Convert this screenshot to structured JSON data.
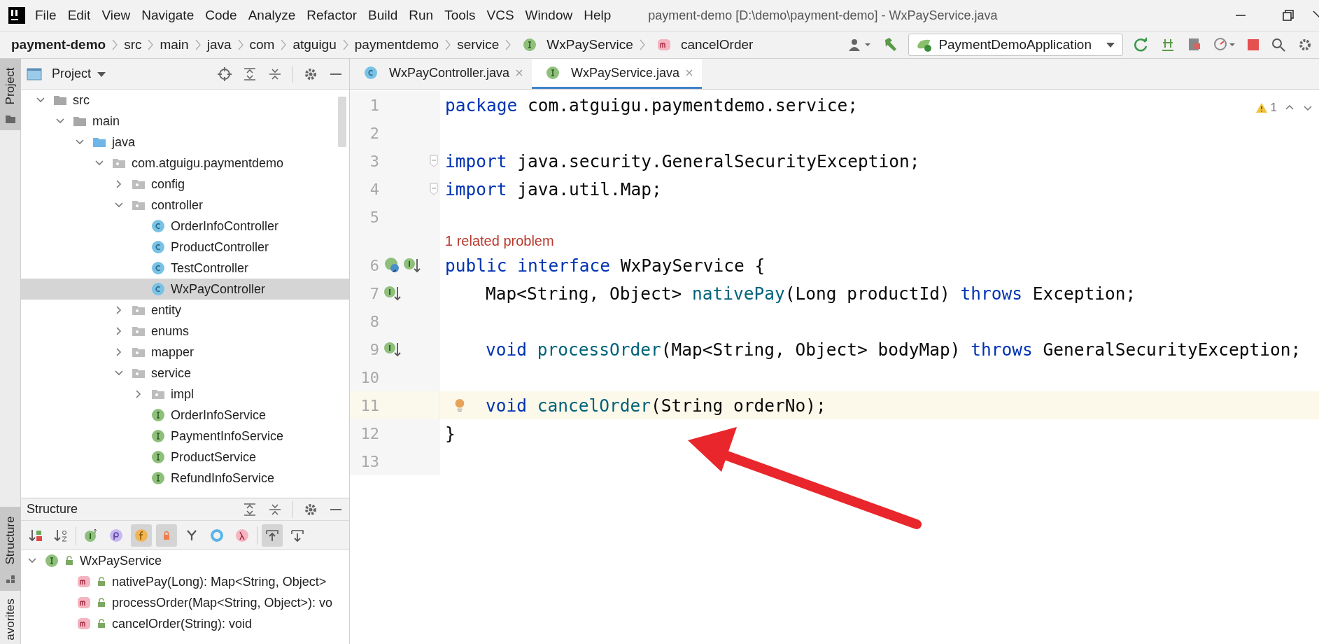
{
  "menu": [
    {
      "label": "File"
    },
    {
      "label": "Edit"
    },
    {
      "label": "View"
    },
    {
      "label": "Navigate"
    },
    {
      "label": "Code"
    },
    {
      "label": "Analyze"
    },
    {
      "label": "Refactor"
    },
    {
      "label": "Build"
    },
    {
      "label": "Run"
    },
    {
      "label": "Tools"
    },
    {
      "label": "VCS"
    },
    {
      "label": "Window"
    },
    {
      "label": "Help"
    }
  ],
  "window_title": "payment-demo [D:\\demo\\payment-demo] - WxPayService.java",
  "breadcrumbs": [
    {
      "label": "payment-demo",
      "kind": "project"
    },
    {
      "label": "src",
      "kind": "plain"
    },
    {
      "label": "main",
      "kind": "plain"
    },
    {
      "label": "java",
      "kind": "plain"
    },
    {
      "label": "com",
      "kind": "plain"
    },
    {
      "label": "atguigu",
      "kind": "plain"
    },
    {
      "label": "paymentdemo",
      "kind": "plain"
    },
    {
      "label": "service",
      "kind": "plain"
    },
    {
      "label": "WxPayService",
      "kind": "interface"
    },
    {
      "label": "cancelOrder",
      "kind": "method"
    }
  ],
  "run_config": "PaymentDemoApplication",
  "side_stripe": {
    "top": {
      "label": "Project",
      "selected": true
    },
    "middle": {
      "label": "Structure",
      "selected": true
    },
    "bottom": {
      "label": "avorites",
      "selected": false
    }
  },
  "project_panel": {
    "title": "Project",
    "tree": [
      {
        "label": "src",
        "kind": "folder",
        "expanded": true,
        "selected": false,
        "children": [
          {
            "label": "main",
            "kind": "folder",
            "expanded": true,
            "selected": false,
            "children": [
              {
                "label": "java",
                "kind": "source",
                "expanded": true,
                "selected": false,
                "children": [
                  {
                    "label": "com.atguigu.paymentdemo",
                    "kind": "package",
                    "expanded": true,
                    "selected": false,
                    "children": [
                      {
                        "label": "config",
                        "kind": "package",
                        "expanded": false,
                        "selected": false
                      },
                      {
                        "label": "controller",
                        "kind": "package",
                        "expanded": true,
                        "selected": false,
                        "children": [
                          {
                            "label": "OrderInfoController",
                            "kind": "class",
                            "selected": false
                          },
                          {
                            "label": "ProductController",
                            "kind": "class",
                            "selected": false
                          },
                          {
                            "label": "TestController",
                            "kind": "class",
                            "selected": false
                          },
                          {
                            "label": "WxPayController",
                            "kind": "class",
                            "selected": true
                          }
                        ]
                      },
                      {
                        "label": "entity",
                        "kind": "package",
                        "expanded": false,
                        "selected": false
                      },
                      {
                        "label": "enums",
                        "kind": "package",
                        "expanded": false,
                        "selected": false
                      },
                      {
                        "label": "mapper",
                        "kind": "package",
                        "expanded": false,
                        "selected": false
                      },
                      {
                        "label": "service",
                        "kind": "package",
                        "expanded": true,
                        "selected": false,
                        "children": [
                          {
                            "label": "impl",
                            "kind": "package",
                            "expanded": false,
                            "selected": false
                          },
                          {
                            "label": "OrderInfoService",
                            "kind": "interface",
                            "selected": false
                          },
                          {
                            "label": "PaymentInfoService",
                            "kind": "interface",
                            "selected": false
                          },
                          {
                            "label": "ProductService",
                            "kind": "interface",
                            "selected": false
                          },
                          {
                            "label": "RefundInfoService",
                            "kind": "interface",
                            "selected": false
                          }
                        ]
                      }
                    ]
                  }
                ]
              }
            ]
          }
        ]
      }
    ]
  },
  "structure_panel": {
    "title": "Structure",
    "toolbar": [
      {
        "kind": "sort-visibility",
        "on": false
      },
      {
        "kind": "sort-alpha",
        "on": false
      },
      {
        "kind": "inherited",
        "on": false
      },
      {
        "kind": "properties",
        "on": false
      },
      {
        "kind": "fields",
        "on": true
      },
      {
        "kind": "non-public",
        "on": true
      },
      {
        "kind": "hierarchy",
        "on": false
      },
      {
        "kind": "anonymous",
        "on": false
      },
      {
        "kind": "lambdas",
        "on": false
      },
      {
        "kind": "autoscroll-to",
        "on": true
      },
      {
        "kind": "autoscroll-from",
        "on": false
      }
    ],
    "tree": [
      {
        "label": "WxPayService",
        "kind": "interface",
        "expanded": true,
        "selected": false,
        "children": [
          {
            "label": "nativePay(Long): Map<String, Object>",
            "kind": "method",
            "selected": false
          },
          {
            "label": "processOrder(Map<String, Object>): vo",
            "kind": "method",
            "selected": false
          },
          {
            "label": "cancelOrder(String): void",
            "kind": "method",
            "selected": false
          }
        ]
      }
    ]
  },
  "editor": {
    "tabs": [
      {
        "label": "WxPayController.java",
        "kind": "class",
        "selected": false
      },
      {
        "label": "WxPayService.java",
        "kind": "interface",
        "selected": true
      }
    ],
    "warnings": "1",
    "lines": [
      {
        "number": "1",
        "tokens": [
          {
            "text": "package ",
            "kind": "keyword"
          },
          {
            "text": "com.atguigu.paymentdemo.service;",
            "kind": "plain"
          }
        ]
      },
      {
        "number": "2"
      },
      {
        "number": "3",
        "fold": true,
        "tokens": [
          {
            "text": "import ",
            "kind": "keyword"
          },
          {
            "text": "java.security.GeneralSecurityException;",
            "kind": "plain"
          }
        ]
      },
      {
        "number": "4",
        "fold": true,
        "tokens": [
          {
            "text": "import ",
            "kind": "keyword"
          },
          {
            "text": "java.util.Map;",
            "kind": "plain"
          }
        ]
      },
      {
        "number": "5"
      },
      {
        "number": "6",
        "hint": "1 related problem",
        "markers": [
          {
            "kind": "implemented"
          },
          {
            "kind": "implementing"
          }
        ],
        "tokens": [
          {
            "text": "public ",
            "kind": "keyword"
          },
          {
            "text": "interface ",
            "kind": "keyword"
          },
          {
            "text": "WxPayService {",
            "kind": "plain"
          }
        ]
      },
      {
        "number": "7",
        "indented": true,
        "markers": [
          {
            "kind": "implementing"
          }
        ],
        "tokens": [
          {
            "text": "Map<String, Object> ",
            "kind": "plain"
          },
          {
            "text": "nativePay",
            "kind": "function"
          },
          {
            "text": "(Long productId) ",
            "kind": "plain"
          },
          {
            "text": "throws ",
            "kind": "keyword"
          },
          {
            "text": "Exception;",
            "kind": "plain"
          }
        ]
      },
      {
        "number": "8"
      },
      {
        "number": "9",
        "indented": true,
        "markers": [
          {
            "kind": "implementing"
          }
        ],
        "tokens": [
          {
            "text": "void ",
            "kind": "keyword"
          },
          {
            "text": "processOrder",
            "kind": "function"
          },
          {
            "text": "(Map<String, Object> bodyMap) ",
            "kind": "plain"
          },
          {
            "text": "throws ",
            "kind": "keyword"
          },
          {
            "text": "GeneralSecurityException;",
            "kind": "plain"
          }
        ]
      },
      {
        "number": "10"
      },
      {
        "number": "11",
        "indented": true,
        "current": true,
        "bulb": true,
        "tokens": [
          {
            "text": "void ",
            "kind": "keyword"
          },
          {
            "text": "cancelOrder",
            "kind": "function"
          },
          {
            "text": "(String orderNo);",
            "kind": "plain"
          }
        ]
      },
      {
        "number": "12",
        "tokens": [
          {
            "text": "}",
            "kind": "plain"
          }
        ]
      },
      {
        "number": "13"
      }
    ]
  }
}
